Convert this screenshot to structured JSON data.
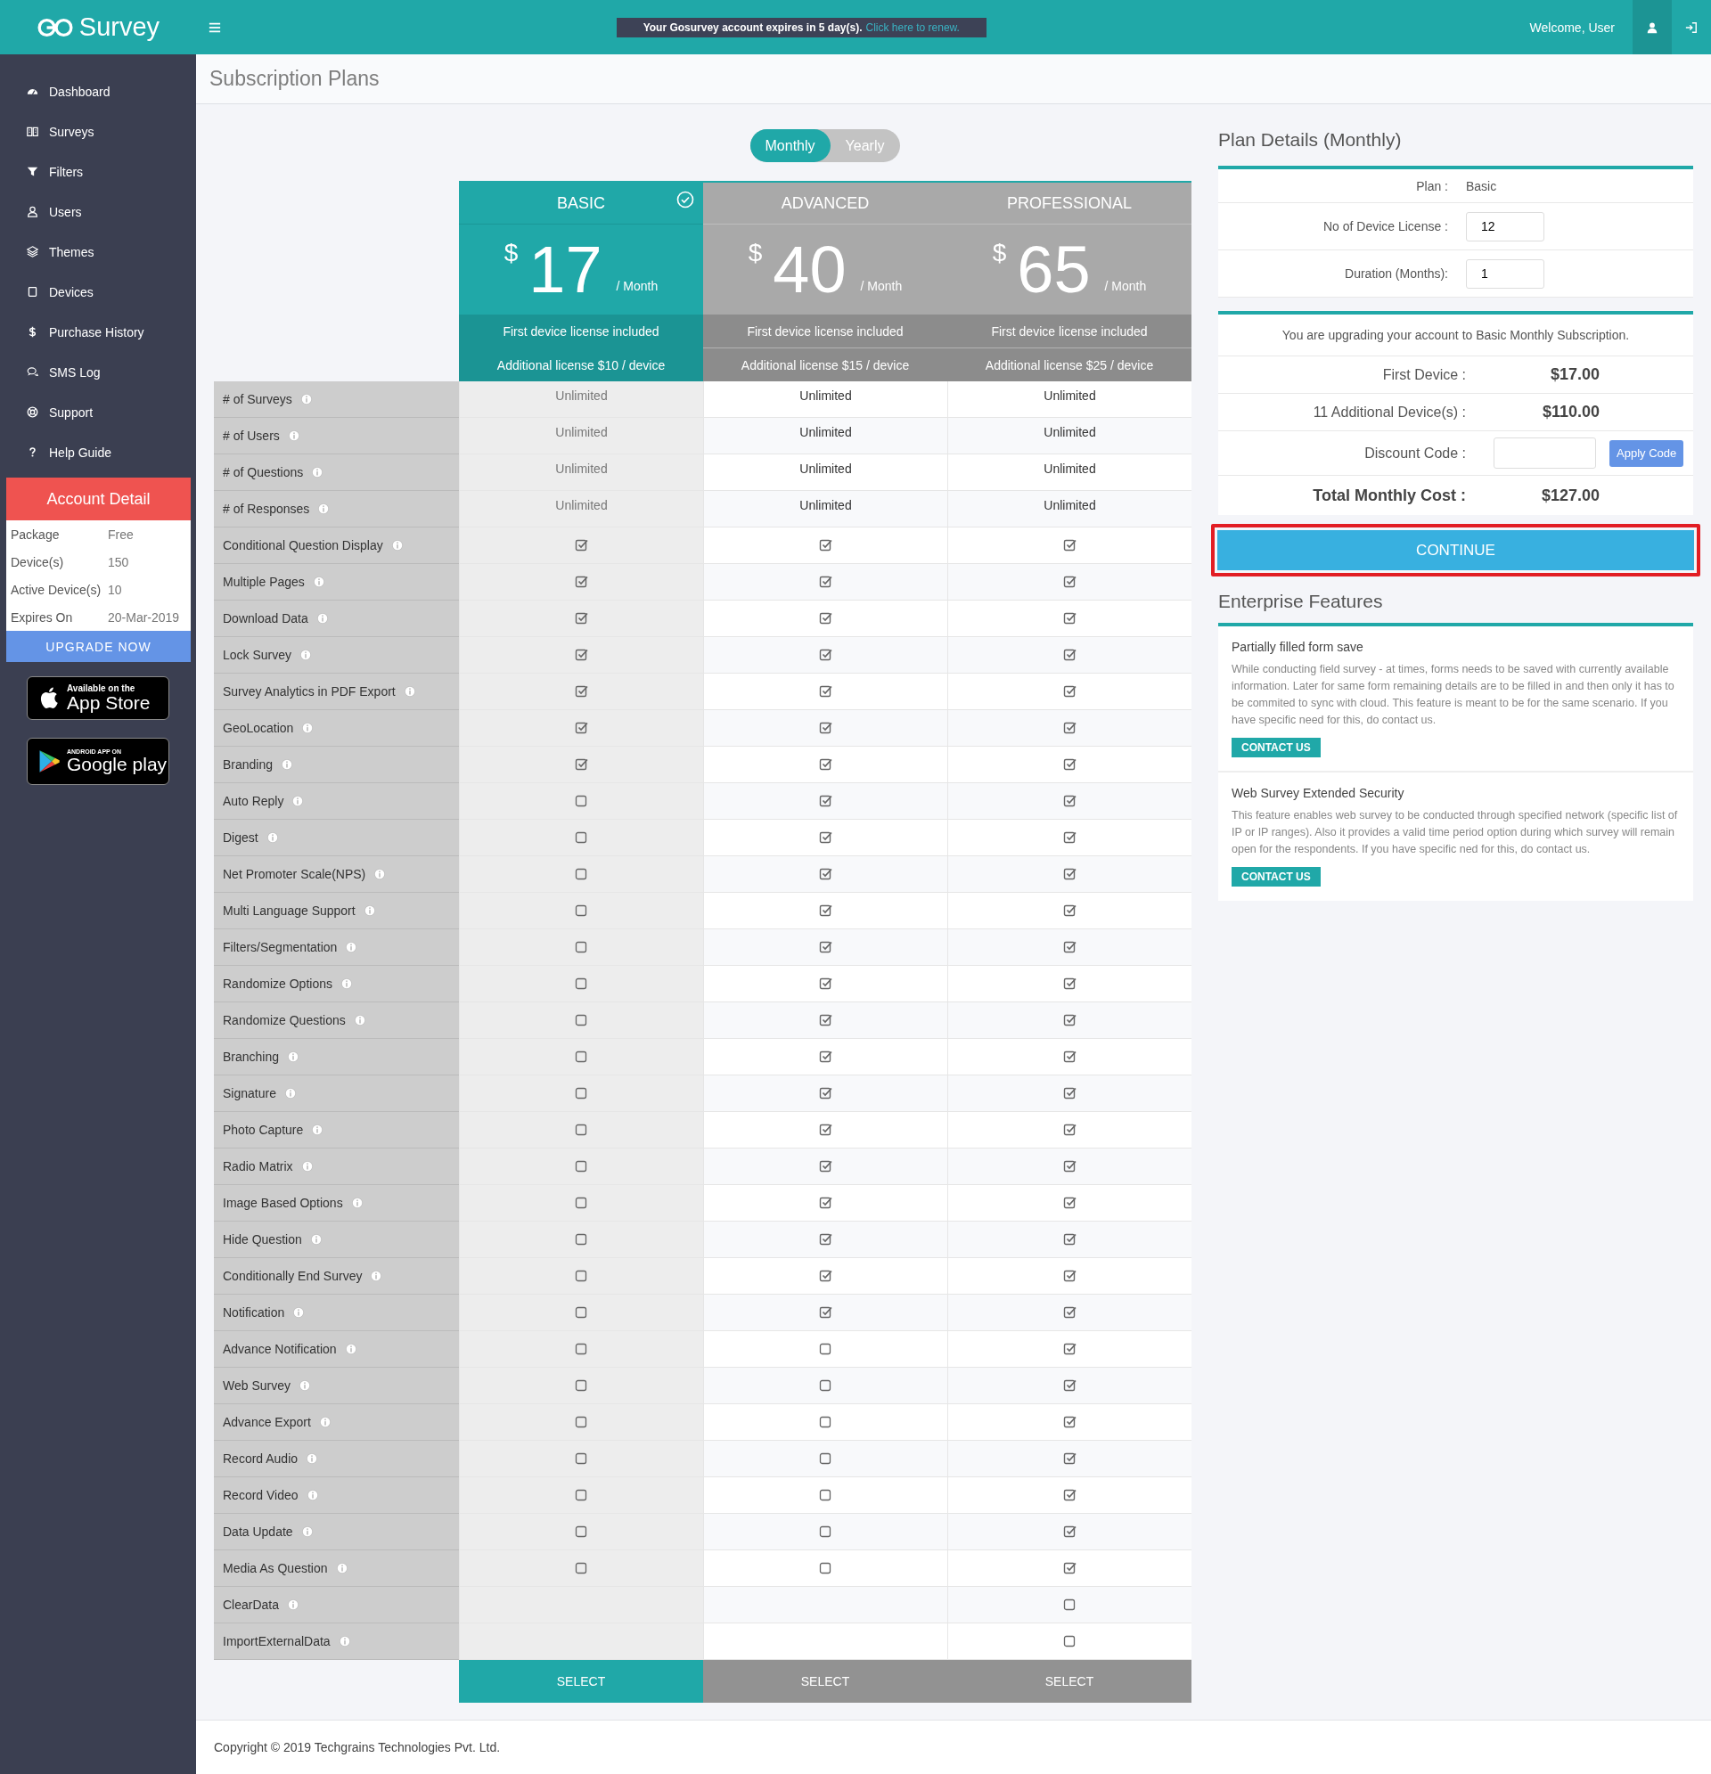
{
  "top_bar": {
    "brand": "Survey",
    "notice": "Your Gosurvey account expires in 5 day(s).",
    "notice_link": "Click here to renew.",
    "welcome": "Welcome, User"
  },
  "sidebar": {
    "items": [
      {
        "label": "Dashboard"
      },
      {
        "label": "Surveys"
      },
      {
        "label": "Filters"
      },
      {
        "label": "Users"
      },
      {
        "label": "Themes"
      },
      {
        "label": "Devices"
      },
      {
        "label": "Purchase History"
      },
      {
        "label": "SMS Log"
      },
      {
        "label": "Support"
      },
      {
        "label": "Help Guide"
      }
    ],
    "account_detail": {
      "title": "Account Detail",
      "rows": [
        {
          "label": "Package",
          "value": "Free"
        },
        {
          "label": "Device(s)",
          "value": "150"
        },
        {
          "label": "Active Device(s)",
          "value": "10"
        },
        {
          "label": "Expires On",
          "value": "20-Mar-2019"
        }
      ],
      "button": "UPGRADE NOW"
    },
    "store_badges": [
      {
        "kind": "apple",
        "small": "Available on the",
        "large": "App Store"
      },
      {
        "kind": "google",
        "small": "ANDROID APP ON",
        "large": "Google play"
      }
    ]
  },
  "page_title": "Subscription Plans",
  "billing_toggle": [
    {
      "label": "Monthly",
      "selected": true
    },
    {
      "label": "Yearly",
      "selected": false
    }
  ],
  "plans": [
    {
      "name": "BASIC",
      "currency": "$",
      "price": "17",
      "period": "/ Month",
      "first_license": "First device license included",
      "additional_license": "Additional license $10 / device",
      "selected": true,
      "button": "SELECT"
    },
    {
      "name": "ADVANCED",
      "currency": "$",
      "price": "40",
      "period": "/ Month",
      "first_license": "First device license included",
      "additional_license": "Additional license $15 / device",
      "selected": false,
      "button": "SELECT"
    },
    {
      "name": "PROFESSIONAL",
      "currency": "$",
      "price": "65",
      "period": "/ Month",
      "first_license": "First device license included",
      "additional_license": "Additional license $25 / device",
      "selected": false,
      "button": "SELECT"
    }
  ],
  "features": [
    {
      "label": "# of Surveys",
      "cells": [
        {
          "kind": "text",
          "text": "Unlimited"
        },
        {
          "kind": "text",
          "text": "Unlimited"
        },
        {
          "kind": "text",
          "text": "Unlimited"
        }
      ]
    },
    {
      "label": "# of Users",
      "cells": [
        {
          "kind": "text",
          "text": "Unlimited"
        },
        {
          "kind": "text",
          "text": "Unlimited"
        },
        {
          "kind": "text",
          "text": "Unlimited"
        }
      ]
    },
    {
      "label": "# of Questions",
      "cells": [
        {
          "kind": "text",
          "text": "Unlimited"
        },
        {
          "kind": "text",
          "text": "Unlimited"
        },
        {
          "kind": "text",
          "text": "Unlimited"
        }
      ]
    },
    {
      "label": "# of Responses",
      "cells": [
        {
          "kind": "text",
          "text": "Unlimited"
        },
        {
          "kind": "text",
          "text": "Unlimited"
        },
        {
          "kind": "text",
          "text": "Unlimited"
        }
      ]
    },
    {
      "label": "Conditional Question Display",
      "cells": [
        {
          "kind": "checkbox",
          "checked": true
        },
        {
          "kind": "checkbox",
          "checked": true
        },
        {
          "kind": "checkbox",
          "checked": true
        }
      ]
    },
    {
      "label": "Multiple Pages",
      "cells": [
        {
          "kind": "checkbox",
          "checked": true
        },
        {
          "kind": "checkbox",
          "checked": true
        },
        {
          "kind": "checkbox",
          "checked": true
        }
      ]
    },
    {
      "label": "Download Data",
      "cells": [
        {
          "kind": "checkbox",
          "checked": true
        },
        {
          "kind": "checkbox",
          "checked": true
        },
        {
          "kind": "checkbox",
          "checked": true
        }
      ]
    },
    {
      "label": "Lock Survey",
      "cells": [
        {
          "kind": "checkbox",
          "checked": true
        },
        {
          "kind": "checkbox",
          "checked": true
        },
        {
          "kind": "checkbox",
          "checked": true
        }
      ]
    },
    {
      "label": "Survey Analytics in PDF Export",
      "cells": [
        {
          "kind": "checkbox",
          "checked": true
        },
        {
          "kind": "checkbox",
          "checked": true
        },
        {
          "kind": "checkbox",
          "checked": true
        }
      ]
    },
    {
      "label": "GeoLocation",
      "cells": [
        {
          "kind": "checkbox",
          "checked": true
        },
        {
          "kind": "checkbox",
          "checked": true
        },
        {
          "kind": "checkbox",
          "checked": true
        }
      ]
    },
    {
      "label": "Branding",
      "cells": [
        {
          "kind": "checkbox",
          "checked": true
        },
        {
          "kind": "checkbox",
          "checked": true
        },
        {
          "kind": "checkbox",
          "checked": true
        }
      ]
    },
    {
      "label": "Auto Reply",
      "cells": [
        {
          "kind": "checkbox",
          "checked": false
        },
        {
          "kind": "checkbox",
          "checked": true
        },
        {
          "kind": "checkbox",
          "checked": true
        }
      ]
    },
    {
      "label": "Digest",
      "cells": [
        {
          "kind": "checkbox",
          "checked": false
        },
        {
          "kind": "checkbox",
          "checked": true
        },
        {
          "kind": "checkbox",
          "checked": true
        }
      ]
    },
    {
      "label": "Net Promoter Scale(NPS)",
      "cells": [
        {
          "kind": "checkbox",
          "checked": false
        },
        {
          "kind": "checkbox",
          "checked": true
        },
        {
          "kind": "checkbox",
          "checked": true
        }
      ]
    },
    {
      "label": "Multi Language Support",
      "cells": [
        {
          "kind": "checkbox",
          "checked": false
        },
        {
          "kind": "checkbox",
          "checked": true
        },
        {
          "kind": "checkbox",
          "checked": true
        }
      ]
    },
    {
      "label": "Filters/Segmentation",
      "cells": [
        {
          "kind": "checkbox",
          "checked": false
        },
        {
          "kind": "checkbox",
          "checked": true
        },
        {
          "kind": "checkbox",
          "checked": true
        }
      ]
    },
    {
      "label": "Randomize Options",
      "cells": [
        {
          "kind": "checkbox",
          "checked": false
        },
        {
          "kind": "checkbox",
          "checked": true
        },
        {
          "kind": "checkbox",
          "checked": true
        }
      ]
    },
    {
      "label": "Randomize Questions",
      "cells": [
        {
          "kind": "checkbox",
          "checked": false
        },
        {
          "kind": "checkbox",
          "checked": true
        },
        {
          "kind": "checkbox",
          "checked": true
        }
      ]
    },
    {
      "label": "Branching",
      "cells": [
        {
          "kind": "checkbox",
          "checked": false
        },
        {
          "kind": "checkbox",
          "checked": true
        },
        {
          "kind": "checkbox",
          "checked": true
        }
      ]
    },
    {
      "label": "Signature",
      "cells": [
        {
          "kind": "checkbox",
          "checked": false
        },
        {
          "kind": "checkbox",
          "checked": true
        },
        {
          "kind": "checkbox",
          "checked": true
        }
      ]
    },
    {
      "label": "Photo Capture",
      "cells": [
        {
          "kind": "checkbox",
          "checked": false
        },
        {
          "kind": "checkbox",
          "checked": true
        },
        {
          "kind": "checkbox",
          "checked": true
        }
      ]
    },
    {
      "label": "Radio Matrix",
      "cells": [
        {
          "kind": "checkbox",
          "checked": false
        },
        {
          "kind": "checkbox",
          "checked": true
        },
        {
          "kind": "checkbox",
          "checked": true
        }
      ]
    },
    {
      "label": "Image Based Options",
      "cells": [
        {
          "kind": "checkbox",
          "checked": false
        },
        {
          "kind": "checkbox",
          "checked": true
        },
        {
          "kind": "checkbox",
          "checked": true
        }
      ]
    },
    {
      "label": "Hide Question",
      "cells": [
        {
          "kind": "checkbox",
          "checked": false
        },
        {
          "kind": "checkbox",
          "checked": true
        },
        {
          "kind": "checkbox",
          "checked": true
        }
      ]
    },
    {
      "label": "Conditionally End Survey",
      "cells": [
        {
          "kind": "checkbox",
          "checked": false
        },
        {
          "kind": "checkbox",
          "checked": true
        },
        {
          "kind": "checkbox",
          "checked": true
        }
      ]
    },
    {
      "label": "Notification",
      "cells": [
        {
          "kind": "checkbox",
          "checked": false
        },
        {
          "kind": "checkbox",
          "checked": true
        },
        {
          "kind": "checkbox",
          "checked": true
        }
      ]
    },
    {
      "label": "Advance Notification",
      "cells": [
        {
          "kind": "checkbox",
          "checked": false
        },
        {
          "kind": "checkbox",
          "checked": false
        },
        {
          "kind": "checkbox",
          "checked": true
        }
      ]
    },
    {
      "label": "Web Survey",
      "cells": [
        {
          "kind": "checkbox",
          "checked": false
        },
        {
          "kind": "checkbox",
          "checked": false
        },
        {
          "kind": "checkbox",
          "checked": true
        }
      ]
    },
    {
      "label": "Advance Export",
      "cells": [
        {
          "kind": "checkbox",
          "checked": false
        },
        {
          "kind": "checkbox",
          "checked": false
        },
        {
          "kind": "checkbox",
          "checked": true
        }
      ]
    },
    {
      "label": "Record Audio",
      "cells": [
        {
          "kind": "checkbox",
          "checked": false
        },
        {
          "kind": "checkbox",
          "checked": false
        },
        {
          "kind": "checkbox",
          "checked": true
        }
      ]
    },
    {
      "label": "Record Video",
      "cells": [
        {
          "kind": "checkbox",
          "checked": false
        },
        {
          "kind": "checkbox",
          "checked": false
        },
        {
          "kind": "checkbox",
          "checked": true
        }
      ]
    },
    {
      "label": "Data Update",
      "cells": [
        {
          "kind": "checkbox",
          "checked": false
        },
        {
          "kind": "checkbox",
          "checked": false
        },
        {
          "kind": "checkbox",
          "checked": true
        }
      ]
    },
    {
      "label": "Media As Question",
      "cells": [
        {
          "kind": "checkbox",
          "checked": false
        },
        {
          "kind": "checkbox",
          "checked": false
        },
        {
          "kind": "checkbox",
          "checked": true
        }
      ]
    },
    {
      "label": "ClearData",
      "cells": [
        {
          "kind": "empty"
        },
        {
          "kind": "empty"
        },
        {
          "kind": "checkbox",
          "checked": false
        }
      ]
    },
    {
      "label": "ImportExternalData",
      "cells": [
        {
          "kind": "empty"
        },
        {
          "kind": "empty"
        },
        {
          "kind": "checkbox",
          "checked": false
        }
      ]
    }
  ],
  "plan_details": {
    "title": "Plan Details (Monthly)",
    "fields": [
      {
        "kind": "static",
        "label": "Plan :",
        "value": "Basic"
      },
      {
        "kind": "input",
        "label": "No of Device License :",
        "value": "12"
      },
      {
        "kind": "input",
        "label": "Duration (Months):",
        "value": "1"
      }
    ],
    "message": "You are upgrading your account to Basic Monthly Subscription.",
    "charges": [
      {
        "kind": "amount",
        "label": "First Device :",
        "value": "$17.00"
      },
      {
        "kind": "amount",
        "label": "11 Additional Device(s) :",
        "value": "$110.00"
      },
      {
        "kind": "discount",
        "label": "Discount Code :",
        "button": "Apply Code"
      },
      {
        "kind": "total",
        "label": "Total Monthly Cost :",
        "value": "$127.00"
      }
    ],
    "continue": {
      "label": "CONTINUE",
      "highlighted": true
    }
  },
  "enterprise": {
    "title": "Enterprise Features",
    "items": [
      {
        "title": "Partially filled form save",
        "description": "While conducting field survey - at times, forms needs to be saved with currently available information. Later for same form remaining details are to be filled in and then only it has to be commited to sync with cloud. This feature is meant to be for the same scenario. If you have specific need for this, do contact us.",
        "button": "CONTACT US"
      },
      {
        "title": "Web Survey Extended Security",
        "description": "This feature enables web survey to be conducted through specified network (specific list of IP or IP ranges). Also it provides a valid time period option during which survey will remain open for the respondents. If you have specific ned for this, do contact us.",
        "button": "CONTACT US"
      }
    ]
  },
  "footer": "Copyright © 2019 Techgrains Technologies Pvt. Ltd."
}
